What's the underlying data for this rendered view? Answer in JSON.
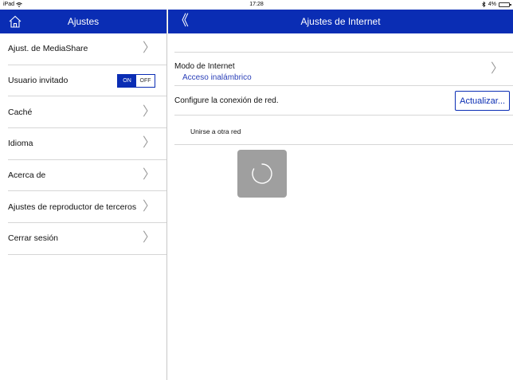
{
  "status_bar": {
    "device": "iPad",
    "time": "17:28",
    "battery": "4%"
  },
  "sidebar": {
    "title": "Ajustes",
    "items": [
      {
        "label": "Ajust. de MediaShare",
        "control": "chevron"
      },
      {
        "label": "Usuario invitado",
        "control": "toggle",
        "toggle_on": "ON",
        "toggle_off": "OFF",
        "state": "ON"
      },
      {
        "label": "Caché",
        "control": "chevron"
      },
      {
        "label": "Idioma",
        "control": "chevron"
      },
      {
        "label": "Acerca de",
        "control": "chevron"
      },
      {
        "label": "Ajustes de reproductor de terceros",
        "control": "chevron"
      },
      {
        "label": "Cerrar sesión",
        "control": "chevron"
      }
    ]
  },
  "main": {
    "title": "Ajustes de Internet",
    "internet_mode": {
      "label": "Modo de Internet",
      "value": "Acceso inalámbrico"
    },
    "network_config": {
      "label": "Configure la conexión de red.",
      "button": "Actualizar..."
    },
    "join_other": {
      "label": "Unirse a otra red"
    }
  },
  "colors": {
    "accent": "#0a2db4",
    "link": "#2a3fb8",
    "separator": "#d6d6d6",
    "spinner_bg": "#8f8f8f"
  },
  "icons": {
    "home": "home-icon",
    "back": "double-chevron-left-icon",
    "chevron": "chevron-right-icon",
    "spinner": "loading-spinner-icon"
  }
}
